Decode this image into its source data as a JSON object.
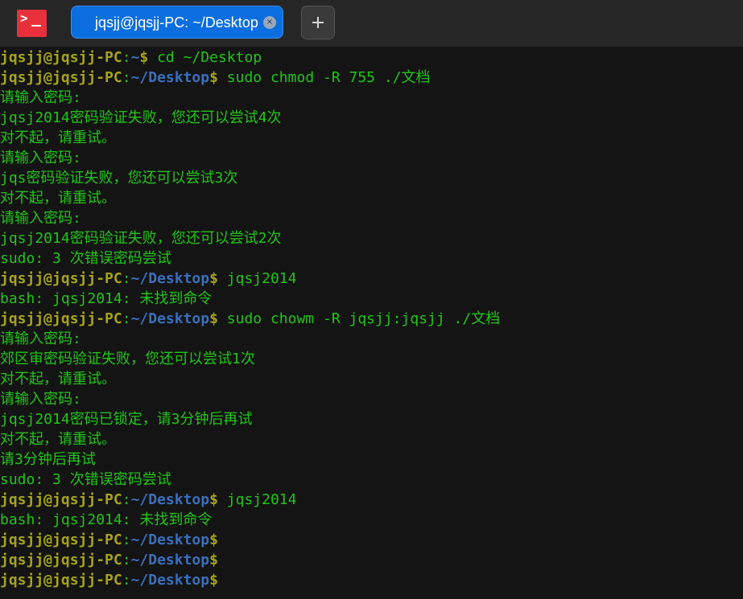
{
  "window": {
    "app_icon_glyph": ">",
    "tab_title": "jqsjj@jqsjj-PC: ~/Desktop",
    "tab_close_glyph": "×",
    "new_tab_glyph": "+"
  },
  "terminal": {
    "colors": {
      "user": "#a6a31a",
      "path": "#3a6fbd",
      "text": "#23c41a",
      "background": "#141414"
    },
    "lines": [
      {
        "type": "prompt",
        "user": "jqsjj@jqsjj-PC",
        "sep": ":",
        "path": "~",
        "sym": "$",
        "cmd": " cd ~/Desktop"
      },
      {
        "type": "prompt",
        "user": "jqsjj@jqsjj-PC",
        "sep": ":",
        "path": "~/Desktop",
        "sym": "$",
        "cmd": " sudo chmod -R 755 ./文档"
      },
      {
        "type": "output",
        "text": "请输入密码:"
      },
      {
        "type": "output",
        "text": "jqsj2014密码验证失败，您还可以尝试4次"
      },
      {
        "type": "output",
        "text": "对不起，请重试。"
      },
      {
        "type": "output",
        "text": "请输入密码:"
      },
      {
        "type": "output",
        "text": "jqs密码验证失败，您还可以尝试3次"
      },
      {
        "type": "output",
        "text": "对不起，请重试。"
      },
      {
        "type": "output",
        "text": "请输入密码:"
      },
      {
        "type": "output",
        "text": "jqsj2014密码验证失败，您还可以尝试2次"
      },
      {
        "type": "output",
        "text": "sudo: 3 次错误密码尝试"
      },
      {
        "type": "prompt",
        "user": "jqsjj@jqsjj-PC",
        "sep": ":",
        "path": "~/Desktop",
        "sym": "$",
        "cmd": " jqsj2014"
      },
      {
        "type": "output",
        "text": "bash: jqsj2014: 未找到命令"
      },
      {
        "type": "prompt",
        "user": "jqsjj@jqsjj-PC",
        "sep": ":",
        "path": "~/Desktop",
        "sym": "$",
        "cmd": " sudo chowm -R jqsjj:jqsjj ./文档"
      },
      {
        "type": "output",
        "text": "请输入密码:"
      },
      {
        "type": "output",
        "text": "郊区审密码验证失败，您还可以尝试1次"
      },
      {
        "type": "output",
        "text": "对不起，请重试。"
      },
      {
        "type": "output",
        "text": "请输入密码:"
      },
      {
        "type": "output",
        "text": "jqsj2014密码已锁定，请3分钟后再试"
      },
      {
        "type": "output",
        "text": "对不起，请重试。"
      },
      {
        "type": "output",
        "text": "请3分钟后再试"
      },
      {
        "type": "output",
        "text": "sudo: 3 次错误密码尝试"
      },
      {
        "type": "prompt",
        "user": "jqsjj@jqsjj-PC",
        "sep": ":",
        "path": "~/Desktop",
        "sym": "$",
        "cmd": " jqsj2014"
      },
      {
        "type": "output",
        "text": "bash: jqsj2014: 未找到命令"
      },
      {
        "type": "prompt",
        "user": "jqsjj@jqsjj-PC",
        "sep": ":",
        "path": "~/Desktop",
        "sym": "$",
        "cmd": ""
      },
      {
        "type": "prompt",
        "user": "jqsjj@jqsjj-PC",
        "sep": ":",
        "path": "~/Desktop",
        "sym": "$",
        "cmd": ""
      },
      {
        "type": "prompt",
        "user": "jqsjj@jqsjj-PC",
        "sep": ":",
        "path": "~/Desktop",
        "sym": "$",
        "cmd": ""
      }
    ]
  }
}
